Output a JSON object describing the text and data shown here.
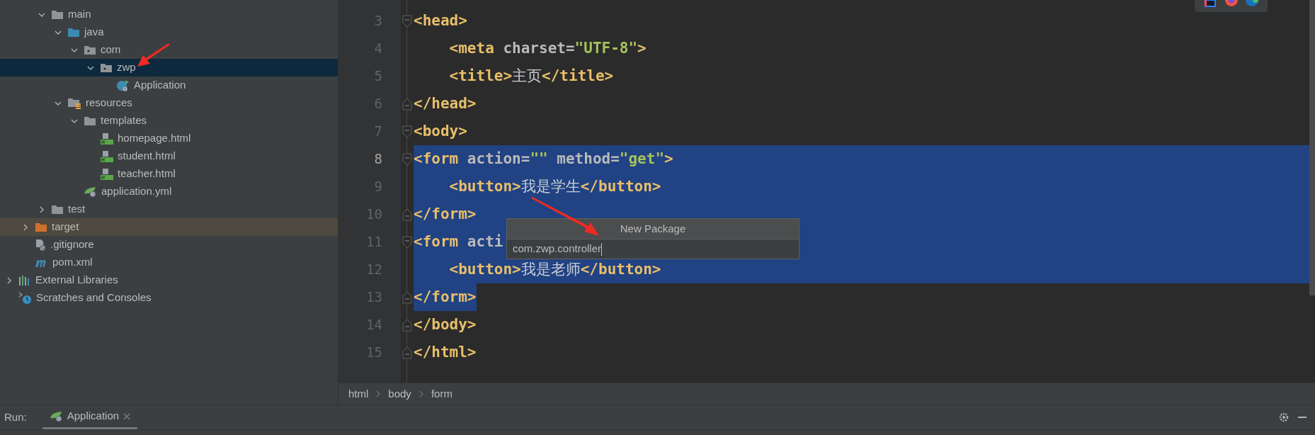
{
  "project_tree": [
    {
      "children": [
        {
          "children": [
            {
              "label": "main",
              "kind": "folder",
              "expanded": true,
              "selected": false,
              "children": [
                {
                  "label": "java",
                  "kind": "source-folder",
                  "expanded": true,
                  "selected": false,
                  "children": [
                    {
                      "label": "com",
                      "kind": "package",
                      "expanded": true,
                      "selected": false,
                      "children": [
                        {
                          "label": "zwp",
                          "kind": "package",
                          "expanded": true,
                          "selected": true,
                          "children": [
                            {
                              "label": "Application",
                              "kind": "class",
                              "selected": false
                            }
                          ]
                        }
                      ]
                    }
                  ]
                },
                {
                  "label": "resources",
                  "kind": "resources",
                  "expanded": true,
                  "selected": false,
                  "children": [
                    {
                      "label": "templates",
                      "kind": "folder",
                      "expanded": true,
                      "selected": false,
                      "children": [
                        {
                          "label": "homepage.html",
                          "kind": "html",
                          "selected": false
                        },
                        {
                          "label": "student.html",
                          "kind": "html",
                          "selected": false
                        },
                        {
                          "label": "teacher.html",
                          "kind": "html",
                          "selected": false
                        }
                      ]
                    },
                    {
                      "label": "application.yml",
                      "kind": "yml",
                      "selected": false
                    }
                  ]
                }
              ]
            },
            {
              "label": "test",
              "kind": "folder",
              "expanded": false,
              "selected": false
            }
          ]
        },
        {
          "label": "target",
          "kind": "excluded",
          "expanded": false,
          "selected": false
        },
        {
          "label": ".gitignore",
          "kind": "git",
          "selected": false
        },
        {
          "label": "pom.xml",
          "kind": "maven",
          "selected": false
        }
      ]
    },
    {
      "label": "External Libraries",
      "kind": "libraries",
      "expanded": false,
      "selected": false
    },
    {
      "label": "Scratches and Consoles",
      "kind": "scratches",
      "selected": false
    }
  ],
  "editor": {
    "lines": [
      {
        "number": "3",
        "fold_start": true,
        "fold_end": false,
        "selected": false,
        "current": false,
        "tokens": [
          {
            "kind": "tag",
            "text": "<head>"
          }
        ]
      },
      {
        "number": "4",
        "fold_start": false,
        "fold_end": false,
        "selected": false,
        "current": false,
        "tokens": [
          {
            "kind": "tag",
            "text": "    <meta"
          },
          {
            "kind": "attr",
            "text": " charset="
          },
          {
            "kind": "str",
            "text": "\"UTF-8\""
          },
          {
            "kind": "tag",
            "text": ">"
          }
        ]
      },
      {
        "number": "5",
        "fold_start": false,
        "fold_end": false,
        "selected": false,
        "current": false,
        "tokens": [
          {
            "kind": "tag",
            "text": "    <title>"
          },
          {
            "kind": "text",
            "text": "主页"
          },
          {
            "kind": "tag",
            "text": "</title>"
          }
        ]
      },
      {
        "number": "6",
        "fold_start": false,
        "fold_end": true,
        "selected": false,
        "current": false,
        "tokens": [
          {
            "kind": "tag",
            "text": "</head>"
          }
        ]
      },
      {
        "number": "7",
        "fold_start": true,
        "fold_end": false,
        "selected": false,
        "current": false,
        "tokens": [
          {
            "kind": "tag",
            "text": "<body>"
          }
        ]
      },
      {
        "number": "8",
        "fold_start": true,
        "fold_end": false,
        "selected": true,
        "current": true,
        "tokens": [
          {
            "kind": "tag",
            "text": "<form"
          },
          {
            "kind": "attr",
            "text": " action="
          },
          {
            "kind": "str",
            "text": "\"\""
          },
          {
            "kind": "attr",
            "text": " method="
          },
          {
            "kind": "str",
            "text": "\"get\""
          },
          {
            "kind": "tag",
            "text": ">"
          }
        ]
      },
      {
        "number": "9",
        "fold_start": false,
        "fold_end": false,
        "selected": true,
        "current": false,
        "tokens": [
          {
            "kind": "tag",
            "text": "    <button>"
          },
          {
            "kind": "text",
            "text": "我是学生"
          },
          {
            "kind": "tag",
            "text": "</button>"
          }
        ]
      },
      {
        "number": "10",
        "fold_start": false,
        "fold_end": true,
        "selected": true,
        "current": false,
        "tokens": [
          {
            "kind": "tag",
            "text": "</form>"
          }
        ]
      },
      {
        "number": "11",
        "fold_start": true,
        "fold_end": false,
        "selected": true,
        "current": false,
        "tokens": [
          {
            "kind": "tag",
            "text": "<form"
          },
          {
            "kind": "attr",
            "text": " acti"
          }
        ]
      },
      {
        "number": "12",
        "fold_start": false,
        "fold_end": false,
        "selected": true,
        "current": false,
        "tokens": [
          {
            "kind": "tag",
            "text": "    <button>"
          },
          {
            "kind": "text",
            "text": "我是老师"
          },
          {
            "kind": "tag",
            "text": "</button>"
          }
        ]
      },
      {
        "number": "13",
        "fold_start": false,
        "fold_end": true,
        "selected": true,
        "current": false,
        "tokens": [
          {
            "kind": "tag",
            "text": "</form>"
          }
        ]
      },
      {
        "number": "14",
        "fold_start": false,
        "fold_end": true,
        "selected": false,
        "current": false,
        "tokens": [
          {
            "kind": "tag",
            "text": "</body>"
          }
        ]
      },
      {
        "number": "15",
        "fold_start": false,
        "fold_end": true,
        "selected": false,
        "current": false,
        "tokens": [
          {
            "kind": "tag",
            "text": "</html>"
          }
        ]
      }
    ]
  },
  "popup": {
    "title": "New Package",
    "value": "com.zwp.controller"
  },
  "breadcrumbs": [
    "html",
    "body",
    "form"
  ],
  "run_bar": {
    "label": "Run:",
    "tab": "Application"
  }
}
